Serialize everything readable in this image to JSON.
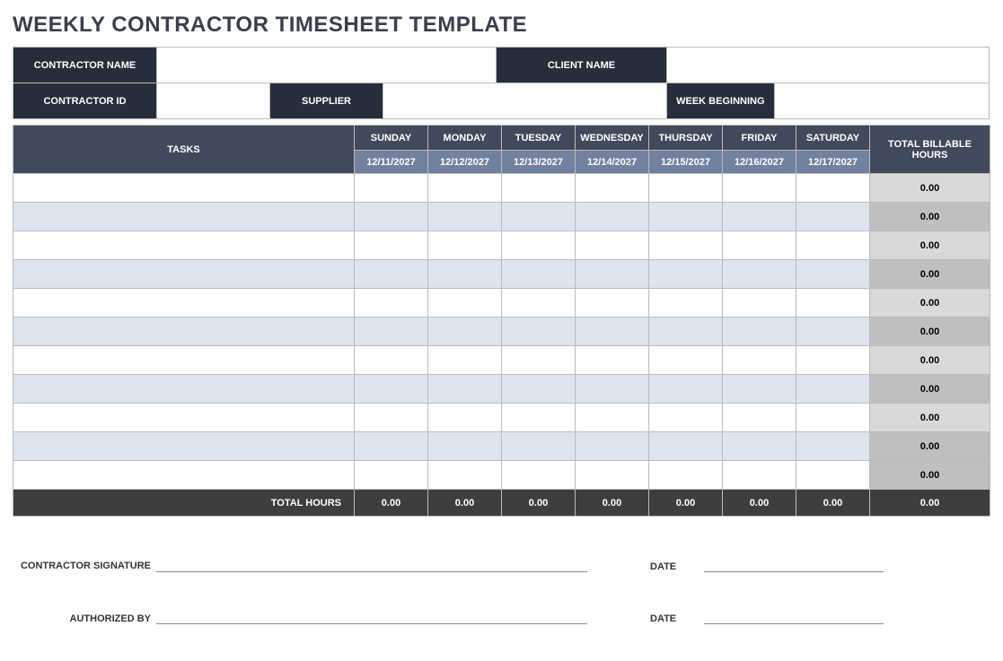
{
  "title": "WEEKLY CONTRACTOR TIMESHEET TEMPLATE",
  "header": {
    "contractor_name_label": "CONTRACTOR NAME",
    "contractor_name_value": "",
    "client_name_label": "CLIENT NAME",
    "client_name_value": "",
    "contractor_id_label": "CONTRACTOR ID",
    "contractor_id_value": "",
    "supplier_label": "SUPPLIER",
    "supplier_value": "",
    "week_beginning_label": "WEEK BEGINNING",
    "week_beginning_value": ""
  },
  "columns": {
    "tasks": "TASKS",
    "total_header": "TOTAL BILLABLE HOURS",
    "days": [
      {
        "name": "SUNDAY",
        "date": "12/11/2027"
      },
      {
        "name": "MONDAY",
        "date": "12/12/2027"
      },
      {
        "name": "TUESDAY",
        "date": "12/13/2027"
      },
      {
        "name": "WEDNESDAY",
        "date": "12/14/2027"
      },
      {
        "name": "THURSDAY",
        "date": "12/15/2027"
      },
      {
        "name": "FRIDAY",
        "date": "12/16/2027"
      },
      {
        "name": "SATURDAY",
        "date": "12/17/2027"
      }
    ]
  },
  "rows": [
    {
      "task": "",
      "d0": "",
      "d1": "",
      "d2": "",
      "d3": "",
      "d4": "",
      "d5": "",
      "d6": "",
      "total": "0.00"
    },
    {
      "task": "",
      "d0": "",
      "d1": "",
      "d2": "",
      "d3": "",
      "d4": "",
      "d5": "",
      "d6": "",
      "total": "0.00"
    },
    {
      "task": "",
      "d0": "",
      "d1": "",
      "d2": "",
      "d3": "",
      "d4": "",
      "d5": "",
      "d6": "",
      "total": "0.00"
    },
    {
      "task": "",
      "d0": "",
      "d1": "",
      "d2": "",
      "d3": "",
      "d4": "",
      "d5": "",
      "d6": "",
      "total": "0.00"
    },
    {
      "task": "",
      "d0": "",
      "d1": "",
      "d2": "",
      "d3": "",
      "d4": "",
      "d5": "",
      "d6": "",
      "total": "0.00"
    },
    {
      "task": "",
      "d0": "",
      "d1": "",
      "d2": "",
      "d3": "",
      "d4": "",
      "d5": "",
      "d6": "",
      "total": "0.00"
    },
    {
      "task": "",
      "d0": "",
      "d1": "",
      "d2": "",
      "d3": "",
      "d4": "",
      "d5": "",
      "d6": "",
      "total": "0.00"
    },
    {
      "task": "",
      "d0": "",
      "d1": "",
      "d2": "",
      "d3": "",
      "d4": "",
      "d5": "",
      "d6": "",
      "total": "0.00"
    },
    {
      "task": "",
      "d0": "",
      "d1": "",
      "d2": "",
      "d3": "",
      "d4": "",
      "d5": "",
      "d6": "",
      "total": "0.00"
    },
    {
      "task": "",
      "d0": "",
      "d1": "",
      "d2": "",
      "d3": "",
      "d4": "",
      "d5": "",
      "d6": "",
      "total": "0.00"
    },
    {
      "task": "",
      "d0": "",
      "d1": "",
      "d2": "",
      "d3": "",
      "d4": "",
      "d5": "",
      "d6": "",
      "total": "0.00"
    }
  ],
  "footer": {
    "label": "TOTAL HOURS",
    "d0": "0.00",
    "d1": "0.00",
    "d2": "0.00",
    "d3": "0.00",
    "d4": "0.00",
    "d5": "0.00",
    "d6": "0.00",
    "total": "0.00"
  },
  "signatures": {
    "contractor_label": "CONTRACTOR SIGNATURE",
    "authorized_label": "AUTHORIZED BY",
    "date_label": "DATE"
  }
}
